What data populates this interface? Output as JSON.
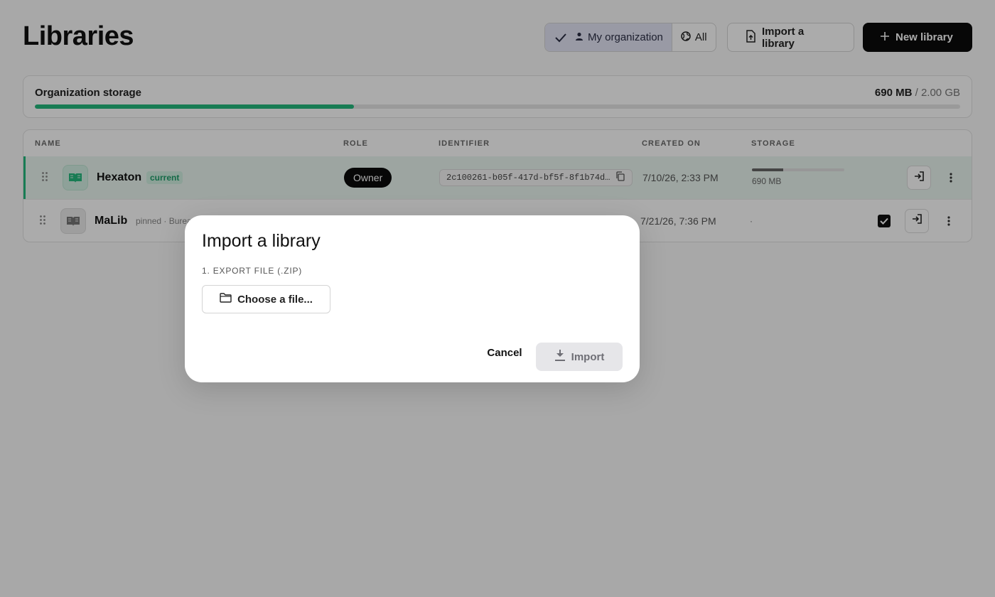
{
  "page": {
    "title": "Libraries"
  },
  "filter": {
    "my_org_label": "My organization",
    "all_label": "All"
  },
  "actions": {
    "import_label": "Import a library",
    "new_label": "New library"
  },
  "storage": {
    "label": "Organization storage",
    "used": "690 MB",
    "separator": " / ",
    "total": "2.00 GB",
    "fraction_used": 0.345
  },
  "table": {
    "headers": {
      "name": "NAME",
      "role": "ROLE",
      "identifier": "IDENTIFIER",
      "created": "CREATED ON",
      "storage": "STORAGE"
    },
    "rows": [
      {
        "name": "Hexaton",
        "tag": "current",
        "role": "Owner",
        "identifier": "2c100261-b05f-417d-bf5f-8f1b74d…",
        "created": "7/10/26, 2:33 PM",
        "storage": "690 MB",
        "storage_fraction": 0.34
      },
      {
        "name": "MaLib",
        "tag": "pinned · Bureau",
        "created": "7/21/26, 7:36 PM",
        "storage": "·"
      }
    ]
  },
  "dialog": {
    "title": "Import a library",
    "field_label": "1. EXPORT FILE (.ZIP)",
    "choose_label": "Choose a file...",
    "cancel_label": "Cancel",
    "import_label": "Import"
  },
  "colors": {
    "accent": "#25b97e",
    "dark": "#0b0b0b",
    "filter_active": "#e4e6f7"
  }
}
